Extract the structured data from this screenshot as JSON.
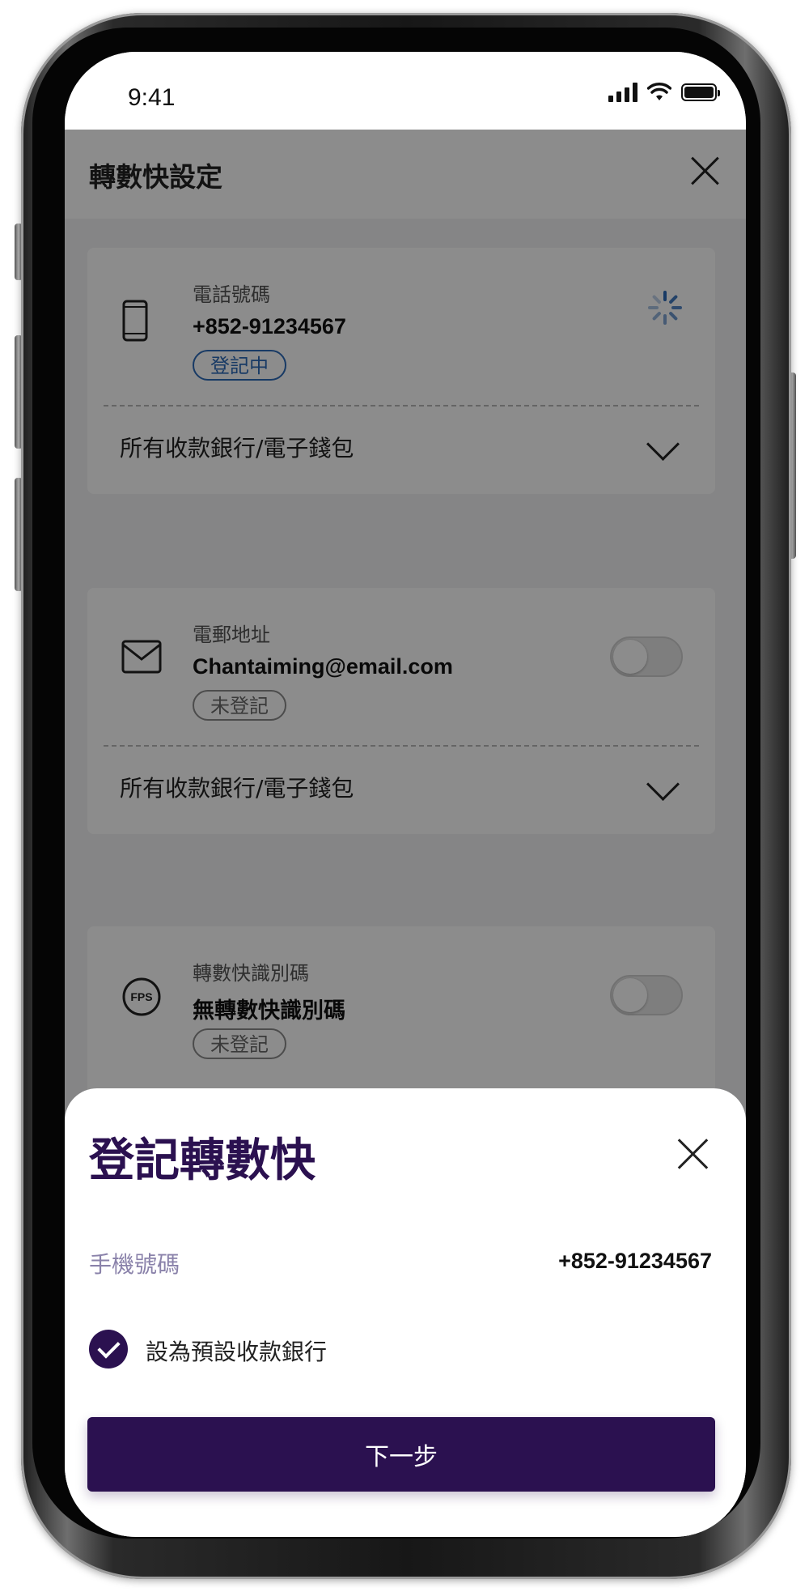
{
  "status_bar": {
    "time": "9:41"
  },
  "header": {
    "title": "轉數快設定"
  },
  "cards": {
    "phone": {
      "label": "電話號碼",
      "value": "+852-91234567",
      "status": "登記中",
      "bank_row": "所有收款銀行/電子錢包"
    },
    "email": {
      "label": "電郵地址",
      "value": "Chantaiming@email.com",
      "status": "未登記",
      "bank_row": "所有收款銀行/電子錢包"
    },
    "fps_id": {
      "label": "轉數快識別碼",
      "value": "無轉數快識別碼",
      "status": "未登記",
      "icon_text": "FPS"
    }
  },
  "sheet": {
    "title": "登記轉數快",
    "mobile_label": "手機號碼",
    "mobile_value": "+852-91234567",
    "default_bank_label": "設為預設收款銀行",
    "next_button": "下一步"
  },
  "colors": {
    "brand_purple": "#2b1150",
    "status_blue": "#2d6bb8",
    "label_lavender": "#8a82aa"
  }
}
